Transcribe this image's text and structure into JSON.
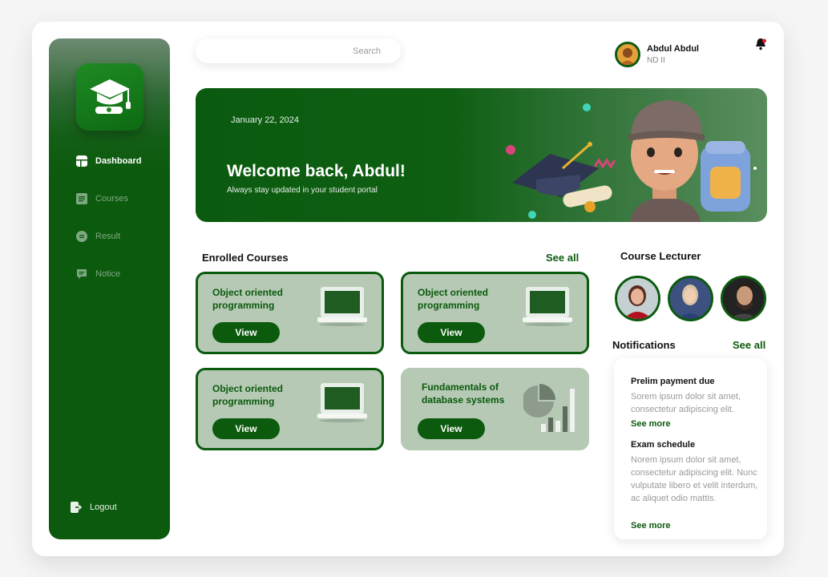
{
  "nav": {
    "items": [
      {
        "label": "Dashboard",
        "icon": "dashboard-icon"
      },
      {
        "label": "Courses",
        "icon": "courses-icon"
      },
      {
        "label": "Result",
        "icon": "result-icon"
      },
      {
        "label": "Notice",
        "icon": "notice-icon"
      }
    ],
    "logout": "Logout"
  },
  "search": {
    "placeholder": "Search"
  },
  "user": {
    "name": "Abdul Abdul",
    "level": "ND II"
  },
  "banner": {
    "date": "January 22, 2024",
    "title": "Welcome back, Abdul!",
    "subtitle": "Always stay updated in your student portal"
  },
  "enrolled": {
    "title": "Enrolled Courses",
    "see_all": "See all",
    "courses": [
      {
        "name": "Object oriented programming",
        "button": "View"
      },
      {
        "name": "Object oriented programming",
        "button": "View"
      },
      {
        "name": "Object oriented programming",
        "button": "View"
      },
      {
        "name": "Fundamentals of database systems",
        "button": "View"
      }
    ]
  },
  "lecturers": {
    "title": "Course Lecturer"
  },
  "notifications": {
    "title": "Notifications",
    "see_all": "See all",
    "items": [
      {
        "title": "Prelim payment due",
        "body": "Sorem ipsum dolor sit amet, consectetur adipiscing elit.",
        "link": "See more"
      },
      {
        "title": "Exam schedule",
        "body": "Norem ipsum dolor sit amet, consectetur adipiscing elit. Nunc vulputate libero et velit interdum, ac aliquet odio mattis.",
        "link": "See more"
      }
    ]
  },
  "colors": {
    "primary": "#0b5a0d",
    "card": "#b5c9b5",
    "accent": "#1f8a24"
  }
}
